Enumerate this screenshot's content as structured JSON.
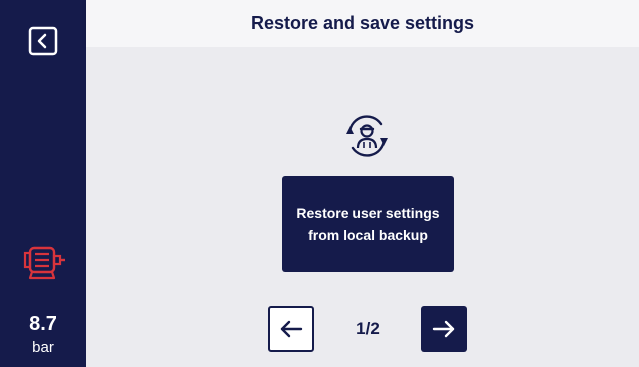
{
  "header": {
    "title": "Restore and save settings"
  },
  "sidebar": {
    "back_icon": "back-icon",
    "motor_icon": "motor-icon",
    "pressure_value": "8.7",
    "pressure_unit": "bar"
  },
  "main": {
    "restore_icon": "user-sync-icon",
    "restore_button_label": "Restore user settings from local backup",
    "pagination": {
      "prev_icon": "arrow-left-icon",
      "next_icon": "arrow-right-icon",
      "page_label": "1/2"
    }
  },
  "colors": {
    "navy": "#151b4b",
    "background": "#ebebef",
    "header_bg": "#f6f6f8",
    "motor_red": "#d8343c",
    "white": "#ffffff"
  }
}
